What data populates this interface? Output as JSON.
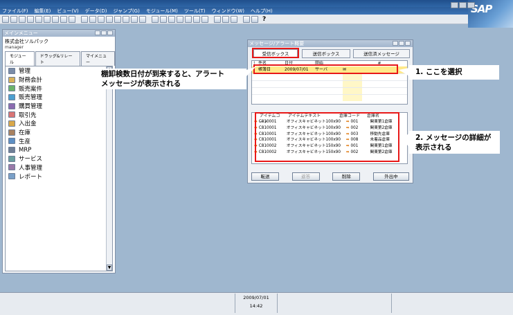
{
  "menubar": {
    "items": [
      "ファイル(F)",
      "編集(E)",
      "ビュー(V)",
      "データ(D)",
      "ジャンプ(G)",
      "モジュール(M)",
      "ツール(T)",
      "ウィンドウ(W)",
      "ヘルプ(H)"
    ]
  },
  "brand": {
    "logo_text": "SAP"
  },
  "toolbar": {
    "help_label": "?"
  },
  "main_menu": {
    "title": "メインメニュー",
    "company": "株式会社ソルパック",
    "user": "manager",
    "tabs": [
      "モジュール",
      "ドラッグ&リレート",
      "マイメニュー"
    ],
    "items": [
      {
        "label": "管理",
        "color": "#7a8ca8"
      },
      {
        "label": "財務会計",
        "color": "#d8b15a"
      },
      {
        "label": "販売案件",
        "color": "#6bb36a"
      },
      {
        "label": "販売管理",
        "color": "#4c9fd0"
      },
      {
        "label": "購買管理",
        "color": "#8c6bb0"
      },
      {
        "label": "取引先",
        "color": "#d97575"
      },
      {
        "label": "入出金",
        "color": "#d9a84a"
      },
      {
        "label": "在庫",
        "color": "#a98260"
      },
      {
        "label": "生産",
        "color": "#5d8fc4"
      },
      {
        "label": "MRP",
        "color": "#6f7f96"
      },
      {
        "label": "サービス",
        "color": "#6aa0a0"
      },
      {
        "label": "人事管理",
        "color": "#9a7aa8"
      },
      {
        "label": "レポート",
        "color": "#7aa0c8"
      }
    ]
  },
  "message_window": {
    "title": "メッセージ/アラート概要",
    "tabs": [
      "受信ボックス",
      "送信ボックス",
      "送信済メッセージ"
    ],
    "list_headers": [
      "!",
      "件名",
      "日付",
      "開始",
      "",
      "#"
    ],
    "rows": [
      {
        "subject": "帳簿日",
        "date": "2009/07/01",
        "from": "サーバ",
        "flag": "✉",
        "num": ""
      }
    ],
    "detail_headers": [
      "アイテムコード",
      "アイテムテキスト",
      "倉庫コード",
      "倉庫名"
    ],
    "detail_rows": [
      {
        "code": "C810001",
        "text": "オフィスキャビネット100x90",
        "wh_code": "001",
        "wh_name": "関東第1倉庫"
      },
      {
        "code": "C810001",
        "text": "オフィスキャビネット100x90",
        "wh_code": "002",
        "wh_name": "関東第2倉庫"
      },
      {
        "code": "C810001",
        "text": "オフィスキャビネット100x90",
        "wh_code": "003",
        "wh_name": "移動先倉庫"
      },
      {
        "code": "C810001",
        "text": "オフィスキャビネット100x90",
        "wh_code": "008",
        "wh_name": "未着品倉庫"
      },
      {
        "code": "C810002",
        "text": "オフィスキャビネット150x90",
        "wh_code": "001",
        "wh_name": "関東第1倉庫"
      },
      {
        "code": "C810002",
        "text": "オフィスキャビネット150x90",
        "wh_code": "002",
        "wh_name": "関東第2倉庫"
      }
    ],
    "buttons": [
      "転送",
      "返答",
      "削除",
      "外出中"
    ]
  },
  "annotations": {
    "note1_line1": "棚卸検数日付が到来すると、アラート",
    "note1_line2": "メッセージが表示される",
    "note2": "1. ここを選択",
    "note3_line1": "2. メッセージの詳細が",
    "note3_line2": "表示される"
  },
  "status": {
    "date": "2009/07/01",
    "time": "14:42"
  },
  "colors": {
    "highlight": "#e81818",
    "selected_row": "#ffe98a",
    "desktop": "#9fb7cf"
  }
}
